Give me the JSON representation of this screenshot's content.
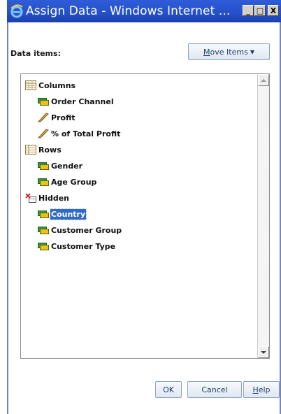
{
  "window": {
    "title": "Assign Data - Windows Internet ...",
    "buttons": {
      "minimize": "_",
      "maximize": "□",
      "close": "X"
    }
  },
  "header": {
    "data_items_label": "Data items:",
    "move_items_button": {
      "accel": "M",
      "rest": "ove Items",
      "caret": "▼"
    }
  },
  "tree": {
    "groups": [
      {
        "label": "Columns",
        "icon": "table-icon",
        "items": [
          {
            "label": "Order Channel",
            "icon": "category-icon"
          },
          {
            "label": "Profit",
            "icon": "measure-icon"
          },
          {
            "label": "% of Total Profit",
            "icon": "measure-icon"
          }
        ]
      },
      {
        "label": "Rows",
        "icon": "table-icon",
        "items": [
          {
            "label": "Gender",
            "icon": "category-icon"
          },
          {
            "label": "Age Group",
            "icon": "category-icon"
          }
        ]
      },
      {
        "label": "Hidden",
        "icon": "hidden-icon",
        "items": [
          {
            "label": "Country",
            "icon": "category-icon",
            "selected": true
          },
          {
            "label": "Customer Group",
            "icon": "category-icon"
          },
          {
            "label": "Customer Type",
            "icon": "category-icon"
          }
        ]
      }
    ]
  },
  "footer": {
    "ok": "OK",
    "cancel": "Cancel",
    "help": {
      "accel": "H",
      "rest": "elp"
    }
  },
  "colors": {
    "titlebar": "#2550c9",
    "selection": "#3169c6",
    "button_text": "#1d3e6e"
  }
}
